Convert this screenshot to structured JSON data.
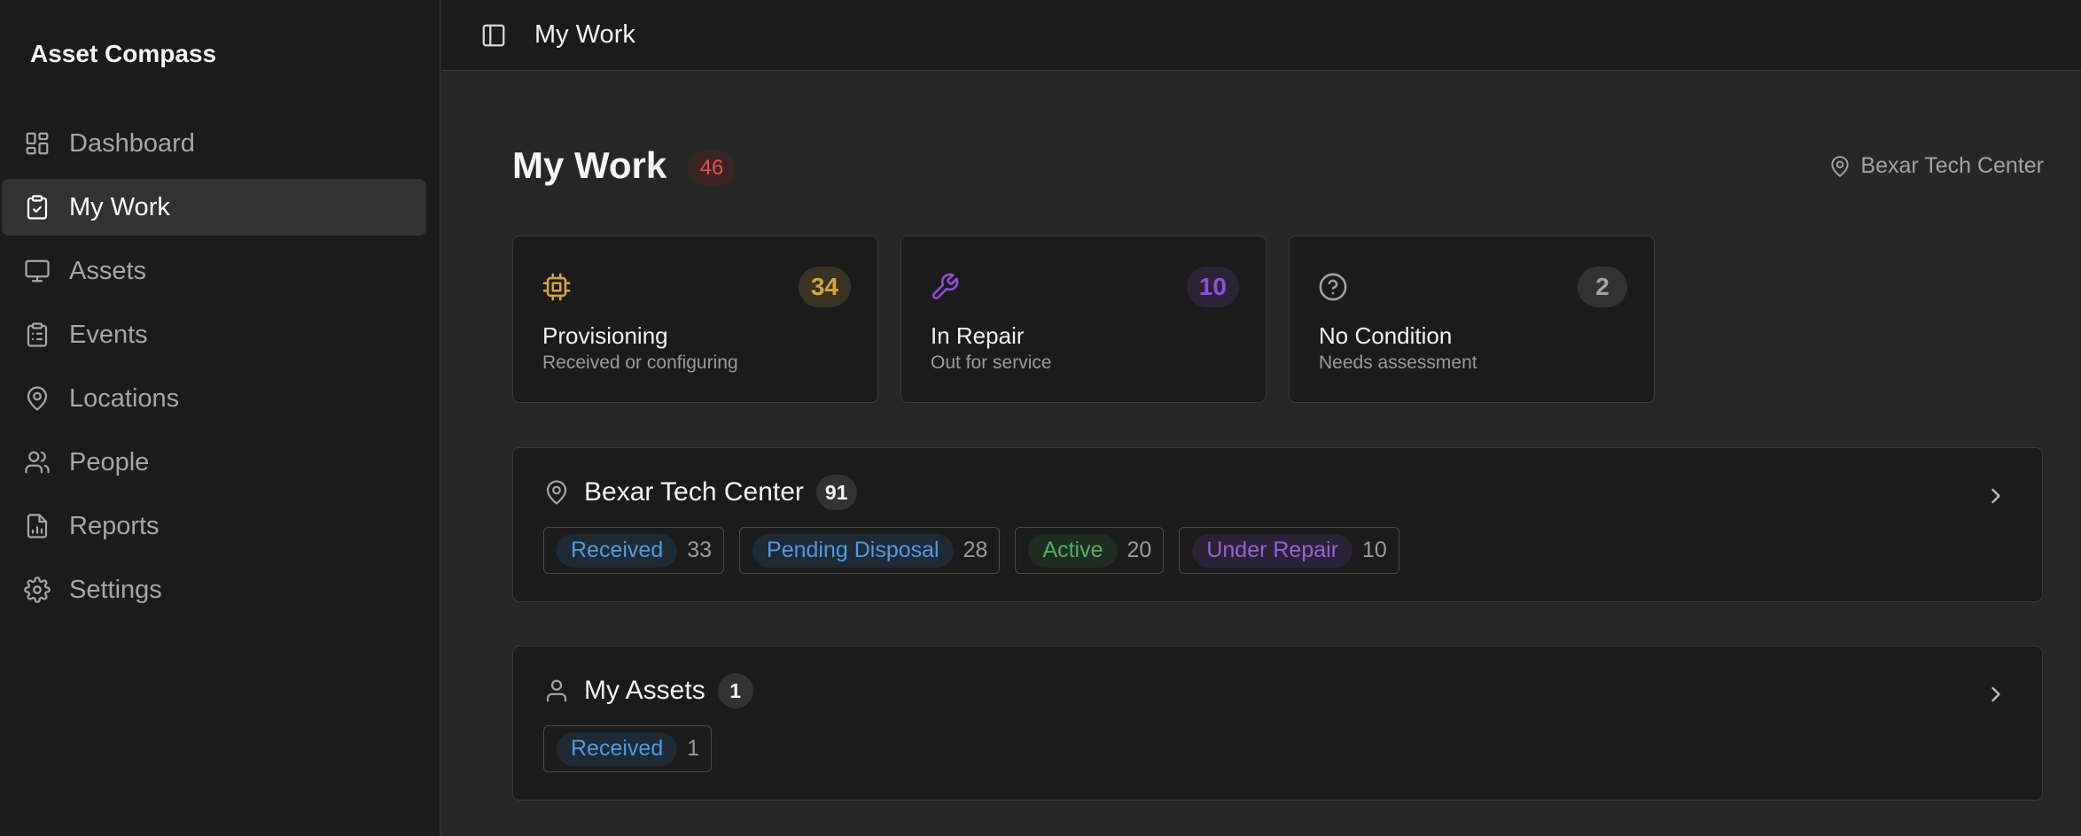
{
  "app": {
    "name": "Asset Compass"
  },
  "sidebar": {
    "items": [
      {
        "label": "Dashboard",
        "icon": "dashboard-icon",
        "active": false
      },
      {
        "label": "My Work",
        "icon": "clipboard-check-icon",
        "active": true
      },
      {
        "label": "Assets",
        "icon": "monitor-icon",
        "active": false
      },
      {
        "label": "Events",
        "icon": "clipboard-list-icon",
        "active": false
      },
      {
        "label": "Locations",
        "icon": "map-pin-icon",
        "active": false
      },
      {
        "label": "People",
        "icon": "users-icon",
        "active": false
      },
      {
        "label": "Reports",
        "icon": "file-chart-icon",
        "active": false
      },
      {
        "label": "Settings",
        "icon": "gear-icon",
        "active": false
      }
    ]
  },
  "topbar": {
    "toggle_icon": "sidebar-toggle-icon",
    "breadcrumb": "My Work"
  },
  "header": {
    "title": "My Work",
    "count": "46",
    "location": "Bexar Tech Center",
    "location_icon": "map-pin-icon"
  },
  "stats": [
    {
      "title": "Provisioning",
      "subtitle": "Received or configuring",
      "count": "34",
      "icon": "cpu-chip-icon",
      "color": "#d4a53a",
      "badge_bg": "#3a3223"
    },
    {
      "title": "In Repair",
      "subtitle": "Out for service",
      "count": "10",
      "icon": "wrench-icon",
      "color": "#8f4fd6",
      "badge_bg": "#2b2338"
    },
    {
      "title": "No Condition",
      "subtitle": "Needs assessment",
      "count": "2",
      "icon": "help-circle-icon",
      "color": "#a3a3a3",
      "badge_bg": "#333333"
    }
  ],
  "groups": [
    {
      "title": "Bexar Tech Center",
      "count": "91",
      "icon": "map-pin-icon",
      "chips": [
        {
          "label": "Received",
          "count": "33",
          "color": "#4f9ae0"
        },
        {
          "label": "Pending Disposal",
          "count": "28",
          "color": "#4f9ae0"
        },
        {
          "label": "Active",
          "count": "20",
          "color": "#4fb063"
        },
        {
          "label": "Under Repair",
          "count": "10",
          "color": "#9a5fd6"
        }
      ]
    },
    {
      "title": "My Assets",
      "count": "1",
      "icon": "user-icon",
      "chips": [
        {
          "label": "Received",
          "count": "1",
          "color": "#4f9ae0"
        }
      ]
    }
  ],
  "colors": {
    "background": "#272727",
    "sidebar": "#1b1b1b",
    "card": "#1b1b1b",
    "alert": "#e65050"
  }
}
